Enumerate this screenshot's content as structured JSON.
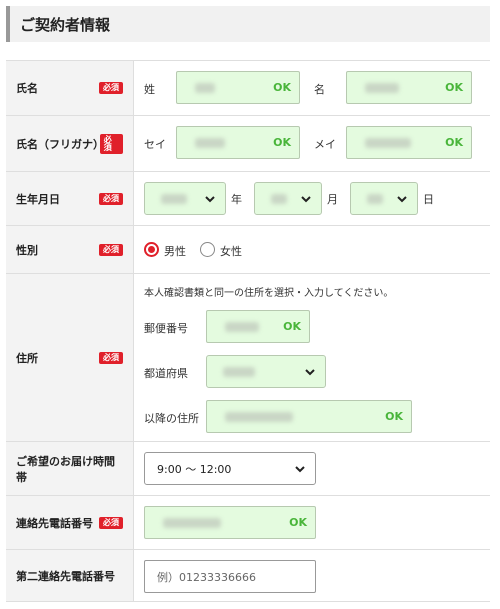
{
  "section": {
    "title": "ご契約者情報"
  },
  "required_badge": "必須",
  "ok_label": "OK",
  "name": {
    "label": "氏名",
    "last_label": "姓",
    "first_label": "名"
  },
  "kana": {
    "label": "氏名（フリガナ）",
    "last_label": "セイ",
    "first_label": "メイ"
  },
  "birth": {
    "label": "生年月日",
    "year_unit": "年",
    "month_unit": "月",
    "day_unit": "日"
  },
  "gender": {
    "label": "性別",
    "options": [
      "男性",
      "女性"
    ],
    "selected": "男性"
  },
  "address": {
    "label": "住所",
    "note": "本人確認書類と同一の住所を選択・入力してください。",
    "postal_label": "郵便番号",
    "pref_label": "都道府県",
    "rest_label": "以降の住所"
  },
  "delivery_time": {
    "label": "ご希望のお届け時間帯",
    "selected": "9:00 〜 12:00"
  },
  "phone": {
    "label": "連絡先電話番号"
  },
  "phone2": {
    "label": "第二連絡先電話番号",
    "placeholder": "例）01233336666"
  },
  "colors": {
    "accent_red": "#e0202a",
    "ok_green": "#49b53a",
    "field_green": "#e4fbdf"
  },
  "icons": [
    "chevron-down-icon",
    "radio-selected-icon",
    "radio-unselected-icon"
  ]
}
